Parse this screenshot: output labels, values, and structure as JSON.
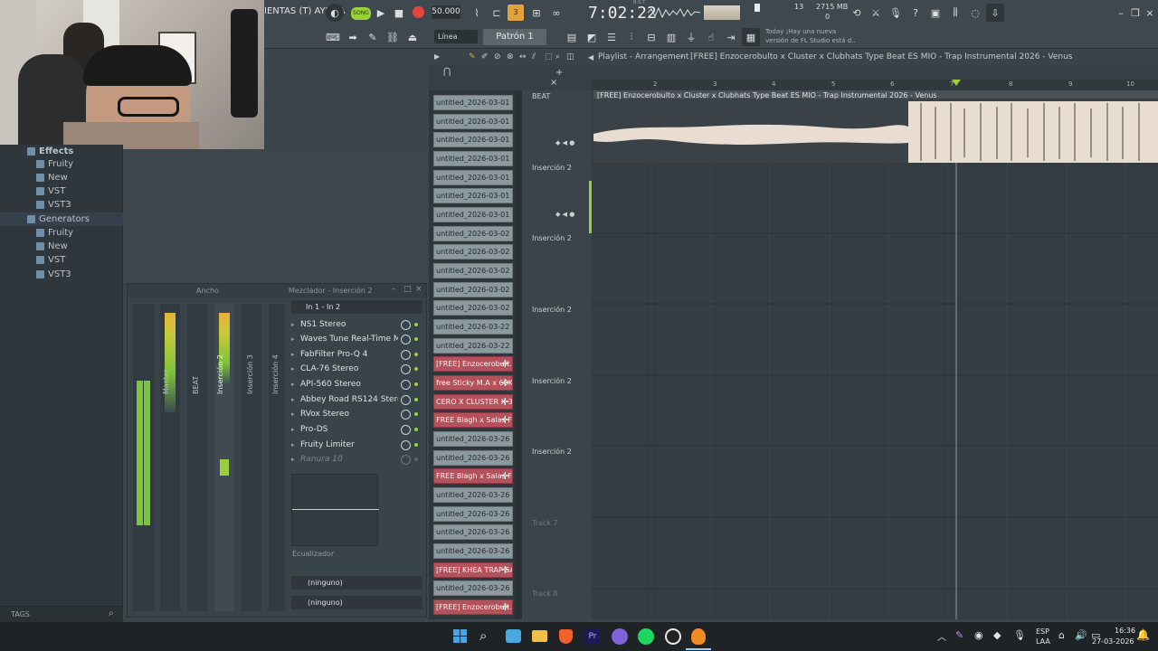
{
  "topbar": {
    "menu_label": "IENTAS (T) AYUDA",
    "song_label": "SONG",
    "tempo": "50.000",
    "time": "7:02:22",
    "time_unit": "B:S:T",
    "cpu_value": "13",
    "memory": "2715 MB",
    "memory_sub": "0",
    "notice_line1": "Today ¡Hay una nueva",
    "notice_line2": "versión de FL Studio está d.."
  },
  "toolbar2": {
    "snap_label": "Línea",
    "pattern_label": "Patrón 1"
  },
  "browser": {
    "items": [
      {
        "label": "Effects",
        "level": 0
      },
      {
        "label": "Fruity",
        "level": 1
      },
      {
        "label": "New",
        "level": 1
      },
      {
        "label": "VST",
        "level": 1
      },
      {
        "label": "VST3",
        "level": 1
      },
      {
        "label": "Generators",
        "level": 0
      },
      {
        "label": "Fruity",
        "level": 1
      },
      {
        "label": "New",
        "level": 1
      },
      {
        "label": "VST",
        "level": 1
      },
      {
        "label": "VST3",
        "level": 1
      }
    ],
    "tags_label": "TAGS"
  },
  "mixer": {
    "title_left": "Ancho",
    "title": "Mezclador - Inserción 2",
    "routing": "In 1 - In 2",
    "strips": [
      "Master",
      "BEAT",
      "Inserción 2",
      "Inserción 3",
      "Inserción 4"
    ],
    "fx_slots": [
      "NS1 Stereo",
      "Waves Tune Real-Time Mo..",
      "FabFilter Pro-Q 4",
      "CLA-76 Stereo",
      "API-560 Stereo",
      "Abbey Road RS124 Stereo",
      "RVox Stereo",
      "Pro-DS",
      "Fruity Limiter",
      "Ranura 10"
    ],
    "eq_label": "Ecualizador",
    "send1": "(ninguno)",
    "send2": "(ninguno)"
  },
  "playlist": {
    "title": "Playlist - Arrangement",
    "breadcrumb": "[FREE] Enzocerobulto x Cluster x Clubhats Type Beat ES MIO - Trap Instrumental 2026 - Venus",
    "ruler": [
      "2",
      "3",
      "4",
      "5",
      "6",
      "7",
      "8",
      "9",
      "10"
    ],
    "wave_clip_title": "[FREE] Enzocerobulto x Cluster x Clubhats Type Beat ES MIO - Trap Instrumental 2026 - Venus",
    "tracks": [
      {
        "label": "BEAT"
      },
      {
        "label": "Inserción 2"
      },
      {
        "label": "Inserción 2"
      },
      {
        "label": "Inserción 2"
      },
      {
        "label": "Inserción 2"
      },
      {
        "label": "Inserción 2"
      },
      {
        "label": "Track 7"
      },
      {
        "label": "Track 8"
      }
    ]
  },
  "clips": [
    {
      "label": "untitled_2026-03-01 00-..",
      "color": "gray"
    },
    {
      "label": "untitled_2026-03-01 00-..",
      "color": "gray"
    },
    {
      "label": "untitled_2026-03-01 00-..",
      "color": "gray"
    },
    {
      "label": "untitled_2026-03-01 00-..",
      "color": "gray"
    },
    {
      "label": "untitled_2026-03-01 00-..",
      "color": "gray"
    },
    {
      "label": "untitled_2026-03-01 00-..",
      "color": "gray"
    },
    {
      "label": "untitled_2026-03-01 00-..",
      "color": "gray"
    },
    {
      "label": "untitled_2026-03-02 01-..",
      "color": "gray"
    },
    {
      "label": "untitled_2026-03-02 01-..",
      "color": "gray"
    },
    {
      "label": "untitled_2026-03-02 01-..",
      "color": "gray"
    },
    {
      "label": "untitled_2026-03-02 01-..",
      "color": "gray"
    },
    {
      "label": "untitled_2026-03-02 01-..",
      "color": "gray"
    },
    {
      "label": "untitled_2026-03-22 00-..",
      "color": "gray"
    },
    {
      "label": "untitled_2026-03-22 00-..",
      "color": "gray"
    },
    {
      "label": "[FREE] Enzocerobult..",
      "color": "red"
    },
    {
      "label": "free Sticky M.A x 60K..",
      "color": "red"
    },
    {
      "label": "CERO X CLUSTER X 3U..",
      "color": "red"
    },
    {
      "label": "FREE Blagh x Salas Fl..",
      "color": "red"
    },
    {
      "label": "untitled_2026-03-26 15-..",
      "color": "gray"
    },
    {
      "label": "untitled_2026-03-26 15-..",
      "color": "gray"
    },
    {
      "label": "FREE Blagh x Salas Fl..",
      "color": "red"
    },
    {
      "label": "untitled_2026-03-26 15-..",
      "color": "gray"
    },
    {
      "label": "untitled_2026-03-26 15-..",
      "color": "gray"
    },
    {
      "label": "untitled_2026-03-26 15-..",
      "color": "gray"
    },
    {
      "label": "untitled_2026-03-26 15-..",
      "color": "gray"
    },
    {
      "label": "[FREE] KHEA TRAP SA..",
      "color": "red"
    },
    {
      "label": "untitled_2026-03-26 15-..",
      "color": "gray"
    },
    {
      "label": "[FREE] Enzocerobult..",
      "color": "red"
    }
  ],
  "taskbar": {
    "lang1": "ESP",
    "lang2": "LAA",
    "clock_time": "16:36",
    "clock_date": "27-03-2026"
  }
}
